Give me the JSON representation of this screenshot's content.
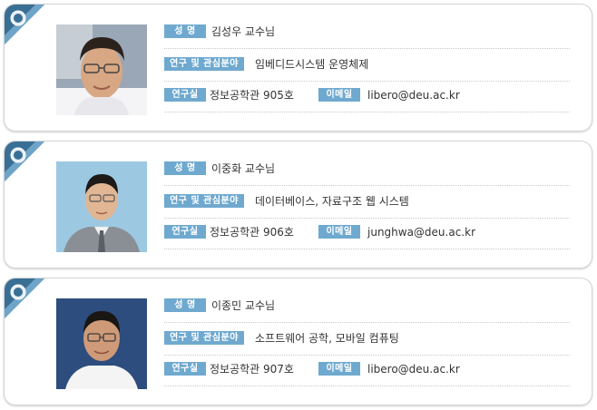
{
  "labels": {
    "name": "성 명",
    "research": "연구 및 관심분야",
    "office": "연구실",
    "email": "이메일"
  },
  "professors": [
    {
      "name": "김성우 교수님",
      "research": "임베디드시스템 운영체제",
      "office": "정보공학관 905호",
      "email": "libero@deu.ac.kr"
    },
    {
      "name": "이중화 교수님",
      "research": "데이터베이스, 자료구조 웹 시스템",
      "office": "정보공학관 906호",
      "email": "junghwa@deu.ac.kr"
    },
    {
      "name": "이종민 교수님",
      "research": "소프트웨어 공학, 모바일 컴퓨팅",
      "office": "정보공학관 907호",
      "email": "libero@deu.ac.kr"
    }
  ],
  "colors": {
    "label_bg": "#6fa9cf",
    "ribbon": "#3a6f95"
  }
}
